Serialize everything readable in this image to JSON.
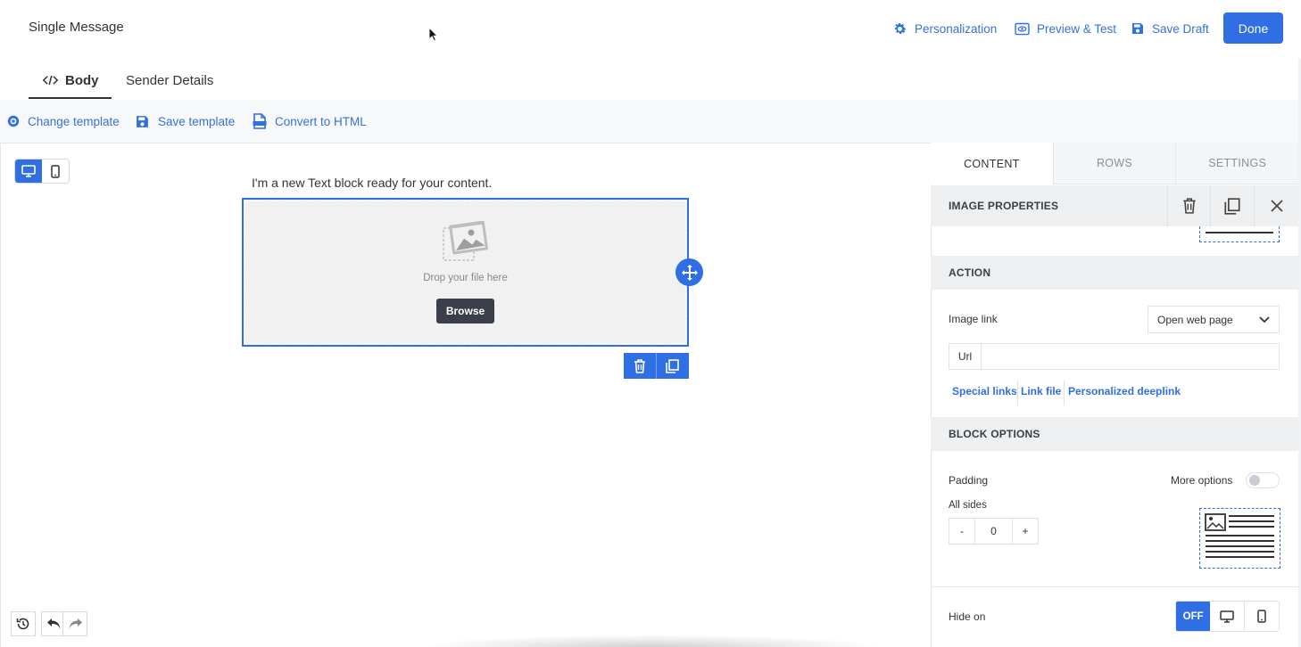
{
  "header": {
    "title": "Single Message",
    "actions": [
      {
        "label": "Personalization",
        "icon": "gear-icon"
      },
      {
        "label": "Preview & Test",
        "icon": "eye-icon"
      },
      {
        "label": "Save Draft",
        "icon": "floppy-icon"
      }
    ],
    "done_label": "Done"
  },
  "tabs": [
    {
      "label": "Body",
      "icon": "code-icon",
      "active": true
    },
    {
      "label": "Sender Details",
      "active": false
    }
  ],
  "toolbar": {
    "change_template": "Change template",
    "save_template": "Save template",
    "convert_html": "Convert to HTML"
  },
  "canvas": {
    "text_block": "I'm a new Text block ready for your content.",
    "image_block": {
      "drop_text": "Drop your file here",
      "browse_label": "Browse"
    }
  },
  "panel": {
    "tabs": [
      "CONTENT",
      "ROWS",
      "SETTINGS"
    ],
    "active_tab": "CONTENT",
    "image_properties_title": "IMAGE PROPERTIES",
    "action": {
      "title": "ACTION",
      "image_link_label": "Image link",
      "image_link_value": "Open web page",
      "url_label": "Url",
      "url_value": "",
      "links": [
        "Special links",
        "Link file",
        "Personalized deeplink"
      ]
    },
    "block_options": {
      "title": "BLOCK OPTIONS",
      "padding_label": "Padding",
      "more_options_label": "More options",
      "more_options_on": false,
      "all_sides_label": "All sides",
      "minus": "-",
      "padding_value": "0",
      "plus": "+"
    },
    "hide_on": {
      "label": "Hide on",
      "off_label": "OFF"
    }
  },
  "colors": {
    "accent": "#2f6ee3",
    "link": "#3a6fd8",
    "dark_button": "#3a3f4b",
    "section_bg": "#eeeff1"
  }
}
